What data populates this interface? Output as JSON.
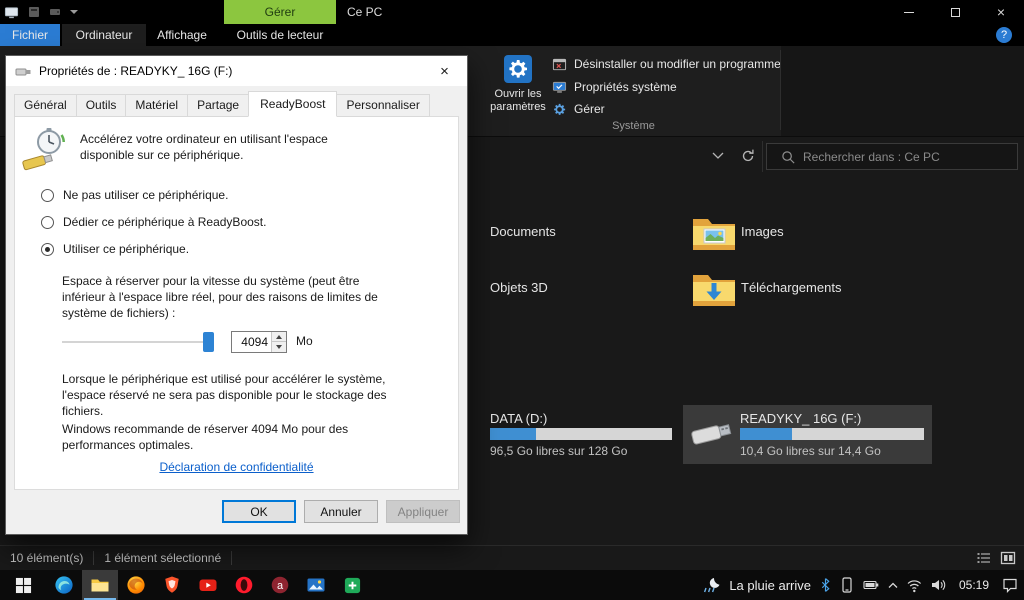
{
  "glyphs": {
    "close": "×",
    "help": "?"
  },
  "titlebar": {
    "manage_label": "Gérer",
    "title": "Ce PC"
  },
  "ribbon_tabs": {
    "file": "Fichier",
    "computer": "Ordinateur",
    "view": "Affichage",
    "drive_tools": "Outils de lecteur"
  },
  "ribbon": {
    "open_settings": "Ouvrir les paramètres",
    "uninstall": "Désinstaller ou modifier un programme",
    "system_properties": "Propriétés système",
    "manage": "Gérer",
    "group_label": "Système"
  },
  "addressbar": {
    "search_placeholder": "Rechercher dans : Ce PC"
  },
  "explorer": {
    "folders": [
      {
        "name": "Documents"
      },
      {
        "name": "Images"
      },
      {
        "name": "Objets 3D"
      },
      {
        "name": "Téléchargements"
      }
    ],
    "drives": [
      {
        "name": "DATA (D:)",
        "free_label": "96,5 Go libres sur 128 Go",
        "used_pct": 25
      },
      {
        "name": "READYKY_ 16G (F:)",
        "free_label": "10,4 Go libres sur 14,4 Go",
        "used_pct": 28,
        "selected": true
      }
    ]
  },
  "statusbar": {
    "count_label": "10 élément(s)",
    "selected_label": "1 élément sélectionné"
  },
  "taskbar": {
    "weather_label": "La pluie arrive",
    "time": "05:19",
    "app_icons": [
      "windows-start",
      "edge",
      "file-explorer",
      "firefox",
      "brave",
      "youtube",
      "opera",
      "letter-a-app",
      "photos",
      "green-app"
    ],
    "tray_icons": [
      "weather-moon-rain",
      "bluetooth",
      "phone",
      "battery",
      "chevron-up",
      "network",
      "volume",
      "notifications"
    ]
  },
  "dialog": {
    "title": "Propriétés de : READYKY_ 16G (F:)",
    "tabs": [
      "Général",
      "Outils",
      "Matériel",
      "Partage",
      "ReadyBoost",
      "Personnaliser"
    ],
    "active_tab": "ReadyBoost",
    "intro": "Accélérez votre ordinateur en utilisant l'espace disponible sur ce périphérique.",
    "radio_options": [
      {
        "label": "Ne pas utiliser ce périphérique.",
        "checked": false
      },
      {
        "label": "Dédier ce périphérique à ReadyBoost.",
        "checked": false
      },
      {
        "label": "Utiliser ce périphérique.",
        "checked": true
      }
    ],
    "reserve_label": "Espace à réserver pour la vitesse du système (peut être inférieur à l'espace libre réel, pour des raisons de limites de système de fichiers) :",
    "reserve_value": "4094",
    "unit": "Mo",
    "note1": "Lorsque le périphérique est utilisé pour accélérer le système, l'espace réservé ne sera pas disponible pour le stockage des fichiers.",
    "note2": "Windows recommande de réserver 4094 Mo pour des performances optimales.",
    "privacy_link": "Déclaration de confidentialité",
    "buttons": {
      "ok": "OK",
      "cancel": "Annuler",
      "apply": "Appliquer"
    }
  },
  "colors": {
    "file_tab_blue": "#2b7cd3",
    "manage_green": "#8cc63f",
    "capacity_fill": "#3f8fd2",
    "link_blue": "#0b5fcb",
    "slider_thumb": "#2d83d4"
  }
}
